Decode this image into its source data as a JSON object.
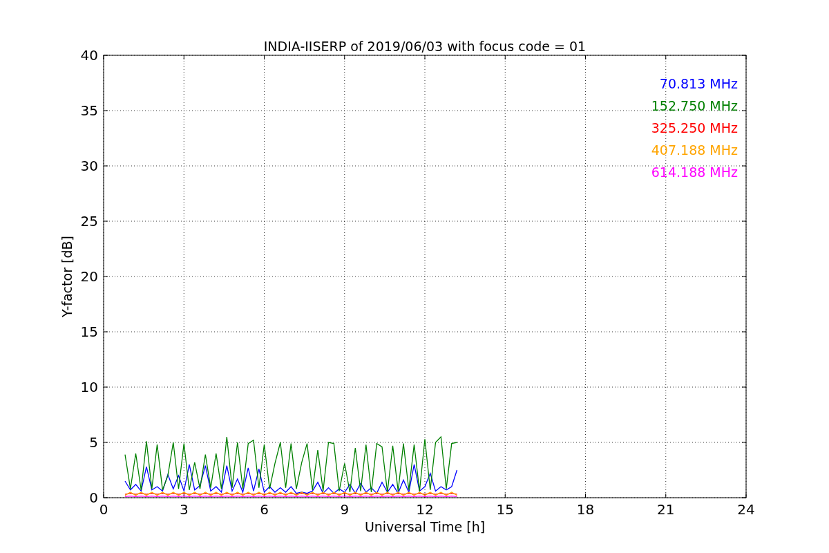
{
  "figure": {
    "chart_data": {
      "type": "line",
      "title": "INDIA-IISERP of 2019/06/03 with focus code = 01",
      "xlabel": "Universal Time [h]",
      "ylabel": "Y-factor [dB]",
      "x": [
        0.8,
        1.0,
        1.2,
        1.4,
        1.6,
        1.8,
        2.0,
        2.2,
        2.4,
        2.6,
        2.8,
        3.0,
        3.2,
        3.4,
        3.6,
        3.8,
        4.0,
        4.2,
        4.4,
        4.6,
        4.8,
        5.0,
        5.2,
        5.4,
        5.6,
        5.8,
        6.0,
        6.2,
        6.4,
        6.6,
        6.8,
        7.0,
        7.2,
        7.4,
        7.6,
        7.8,
        8.0,
        8.2,
        8.4,
        8.6,
        8.8,
        9.0,
        9.2,
        9.4,
        9.6,
        9.8,
        10.0,
        10.2,
        10.4,
        10.6,
        10.8,
        11.0,
        11.2,
        11.4,
        11.6,
        11.8,
        12.0,
        12.2,
        12.4,
        12.6,
        12.8,
        13.0,
        13.2
      ],
      "series": [
        {
          "name": "70.813 MHz",
          "color": "#0000ff",
          "values": [
            1.5,
            0.7,
            1.2,
            0.6,
            2.8,
            0.7,
            1.0,
            0.6,
            2.1,
            0.8,
            2.0,
            0.6,
            3.0,
            0.7,
            1.1,
            2.9,
            0.6,
            1.0,
            0.5,
            2.9,
            0.6,
            1.7,
            0.5,
            2.7,
            0.6,
            2.6,
            0.5,
            1.0,
            0.5,
            0.9,
            0.5,
            1.0,
            0.4,
            0.5,
            0.4,
            0.6,
            1.4,
            0.4,
            0.9,
            0.4,
            0.8,
            0.5,
            1.2,
            0.4,
            1.3,
            0.5,
            0.9,
            0.4,
            1.4,
            0.5,
            1.2,
            0.4,
            1.6,
            0.5,
            3.0,
            0.6,
            1.0,
            2.2,
            0.6,
            1.0,
            0.7,
            1.0,
            2.5
          ]
        },
        {
          "name": "152.750 MHz",
          "color": "#008000",
          "values": [
            3.9,
            0.8,
            4.0,
            0.7,
            5.1,
            0.8,
            4.8,
            0.7,
            2.0,
            5.0,
            0.8,
            4.9,
            0.7,
            3.2,
            0.8,
            3.9,
            0.9,
            4.0,
            0.8,
            5.5,
            0.9,
            5.0,
            0.8,
            4.9,
            5.2,
            0.9,
            4.8,
            0.8,
            3.1,
            5.0,
            0.9,
            4.9,
            0.8,
            3.2,
            4.9,
            0.7,
            4.3,
            0.6,
            5.0,
            4.9,
            0.6,
            3.1,
            0.5,
            4.5,
            0.6,
            4.8,
            0.5,
            4.9,
            4.6,
            0.5,
            4.7,
            0.6,
            4.9,
            0.7,
            4.8,
            0.6,
            5.3,
            0.7,
            5.0,
            5.5,
            0.8,
            4.9,
            5.0
          ]
        },
        {
          "name": "325.250 MHz",
          "color": "#ff0000",
          "values": [
            0.3,
            0.4,
            0.3,
            0.4,
            0.3,
            0.4,
            0.3,
            0.4,
            0.3,
            0.4,
            0.3,
            0.4,
            0.3,
            0.4,
            0.3,
            0.4,
            0.3,
            0.4,
            0.3,
            0.4,
            0.3,
            0.4,
            0.3,
            0.4,
            0.3,
            0.4,
            0.3,
            0.4,
            0.3,
            0.4,
            0.3,
            0.4,
            0.3,
            0.4,
            0.3,
            0.4,
            0.3,
            0.4,
            0.3,
            0.4,
            0.3,
            0.4,
            0.3,
            0.4,
            0.3,
            0.4,
            0.3,
            0.4,
            0.3,
            0.4,
            0.3,
            0.4,
            0.3,
            0.4,
            0.3,
            0.4,
            0.3,
            0.4,
            0.3,
            0.4,
            0.3,
            0.4,
            0.3
          ]
        },
        {
          "name": "407.188 MHz",
          "color": "#ffa500",
          "values": [
            0.2,
            0.5,
            0.2,
            0.5,
            0.2,
            0.5,
            0.2,
            0.5,
            0.2,
            0.5,
            0.2,
            0.5,
            0.2,
            0.5,
            0.2,
            0.5,
            0.2,
            0.5,
            0.2,
            0.5,
            0.2,
            0.5,
            0.2,
            0.5,
            0.2,
            0.5,
            0.2,
            0.5,
            0.2,
            0.5,
            0.2,
            0.5,
            0.2,
            0.5,
            0.2,
            0.5,
            0.2,
            0.5,
            0.2,
            0.5,
            0.2,
            0.5,
            0.2,
            0.5,
            0.2,
            0.5,
            0.2,
            0.5,
            0.2,
            0.5,
            0.2,
            0.5,
            0.2,
            0.5,
            0.2,
            0.5,
            0.2,
            0.5,
            0.2,
            0.5,
            0.2,
            0.5,
            0.2
          ]
        },
        {
          "name": "614.188 MHz",
          "color": "#ff00ff",
          "values": [
            0.1,
            0.15,
            0.1,
            0.15,
            0.1,
            0.15,
            0.1,
            0.15,
            0.1,
            0.15,
            0.1,
            0.15,
            0.1,
            0.15,
            0.1,
            0.15,
            0.1,
            0.15,
            0.1,
            0.15,
            0.1,
            0.15,
            0.1,
            0.15,
            0.1,
            0.15,
            0.1,
            0.15,
            0.1,
            0.15,
            0.1,
            0.15,
            0.1,
            0.15,
            0.1,
            0.15,
            0.1,
            0.15,
            0.1,
            0.15,
            0.1,
            0.15,
            0.1,
            0.15,
            0.1,
            0.15,
            0.1,
            0.15,
            0.1,
            0.15,
            0.1,
            0.15,
            0.1,
            0.15,
            0.1,
            0.15,
            0.1,
            0.15,
            0.1,
            0.15,
            0.1,
            0.15,
            0.1
          ]
        }
      ],
      "xlim": [
        0,
        24
      ],
      "ylim": [
        0,
        40
      ],
      "xticks": [
        0,
        3,
        6,
        9,
        12,
        15,
        18,
        21,
        24
      ],
      "yticks": [
        0,
        5,
        10,
        15,
        20,
        25,
        30,
        35,
        40
      ],
      "grid": true
    }
  }
}
